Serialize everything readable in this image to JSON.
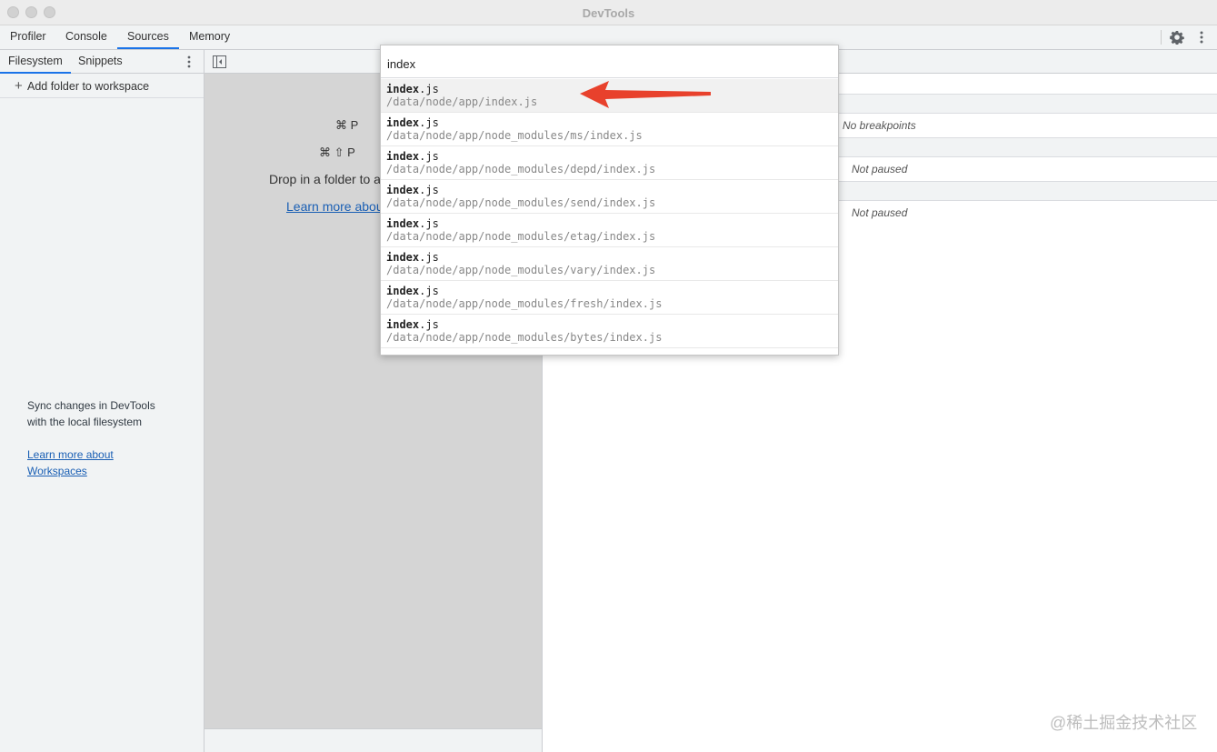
{
  "window": {
    "title": "DevTools"
  },
  "main_tabs": [
    {
      "label": "Profiler"
    },
    {
      "label": "Console"
    },
    {
      "label": "Sources"
    },
    {
      "label": "Memory"
    }
  ],
  "navigator": {
    "tabs": [
      {
        "label": "Filesystem"
      },
      {
        "label": "Snippets"
      }
    ],
    "add_folder_label": "Add folder to workspace",
    "sync_line1": "Sync changes in DevTools",
    "sync_line2": "with the local filesystem",
    "learn_line1": "Learn more about",
    "learn_line2": "Workspaces"
  },
  "editor": {
    "shortcut1_keys": "⌘ P",
    "shortcut2_keys": "⌘ ⇧ P",
    "drop_text": "Drop in a folder to a",
    "learn_link": "Learn more abou"
  },
  "debugger": {
    "no_breakpoints": "No breakpoints",
    "not_paused_1": "Not paused",
    "not_paused_2": "Not paused"
  },
  "quick_open": {
    "query": "index",
    "results": [
      {
        "name_bold": "index",
        "name_rest": ".js",
        "path": "/data/node/app/index.js"
      },
      {
        "name_bold": "index",
        "name_rest": ".js",
        "path": "/data/node/app/node_modules/ms/index.js"
      },
      {
        "name_bold": "index",
        "name_rest": ".js",
        "path": "/data/node/app/node_modules/depd/index.js"
      },
      {
        "name_bold": "index",
        "name_rest": ".js",
        "path": "/data/node/app/node_modules/send/index.js"
      },
      {
        "name_bold": "index",
        "name_rest": ".js",
        "path": "/data/node/app/node_modules/etag/index.js"
      },
      {
        "name_bold": "index",
        "name_rest": ".js",
        "path": "/data/node/app/node_modules/vary/index.js"
      },
      {
        "name_bold": "index",
        "name_rest": ".js",
        "path": "/data/node/app/node_modules/fresh/index.js"
      },
      {
        "name_bold": "index",
        "name_rest": ".js",
        "path": "/data/node/app/node_modules/bytes/index.js"
      }
    ]
  },
  "annotation": {
    "arrow_color": "#e8412c"
  },
  "watermark": "@稀土掘金技术社区",
  "colors": {
    "accent": "#1a73e8",
    "link": "#1a5fb4"
  }
}
